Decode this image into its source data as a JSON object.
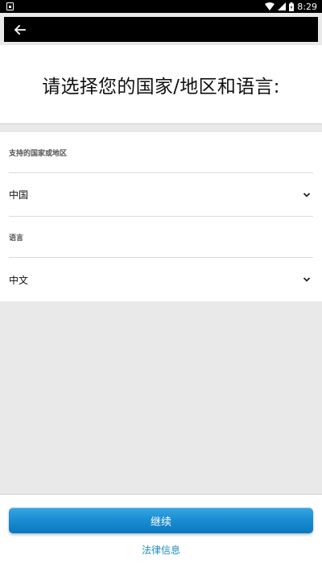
{
  "status_bar": {
    "time": "8:29",
    "icons": [
      "notification-icon",
      "wifi-icon",
      "signal-icon",
      "battery-icon"
    ]
  },
  "app_bar": {
    "back_icon": "back-arrow-icon"
  },
  "header": {
    "title": "请选择您的国家/地区和语言:"
  },
  "form": {
    "country_label": "支持的国家或地区",
    "country_value": "中国",
    "language_label": "语言",
    "language_value": "中文"
  },
  "footer": {
    "continue_label": "继续",
    "legal_link": "法律信息"
  },
  "colors": {
    "accent": "#1b8ed3",
    "link": "#1f8bc9",
    "background": "#e9e9e9"
  }
}
